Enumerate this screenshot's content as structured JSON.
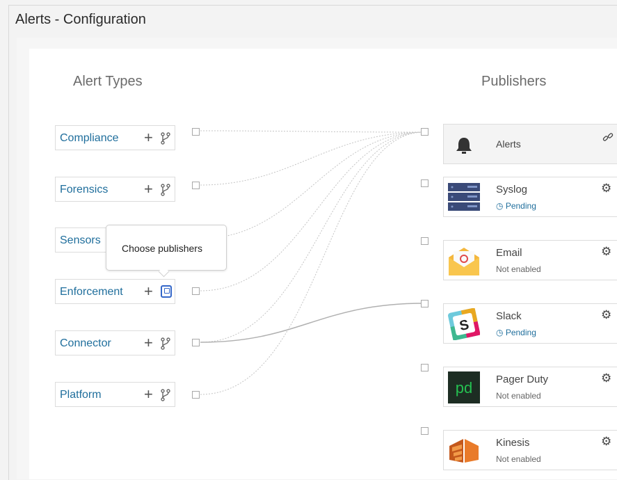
{
  "window": {
    "title": "Alerts - Configuration"
  },
  "headings": {
    "alert_types": "Alert Types",
    "publishers": "Publishers"
  },
  "alert_types": [
    {
      "label": "Compliance"
    },
    {
      "label": "Forensics"
    },
    {
      "label": "Sensors"
    },
    {
      "label": "Enforcement"
    },
    {
      "label": "Connector"
    },
    {
      "label": "Platform"
    }
  ],
  "add_symbol": "+",
  "tooltip": {
    "text": "Choose publishers"
  },
  "publishers": [
    {
      "name": "Alerts",
      "status": "",
      "icon": "bell-icon",
      "action_icon": "link-icon"
    },
    {
      "name": "Syslog",
      "status": "Pending",
      "icon": "server-icon",
      "action_icon": "gear-icon"
    },
    {
      "name": "Email",
      "status": "Not enabled",
      "icon": "email-icon",
      "action_icon": "gear-icon"
    },
    {
      "name": "Slack",
      "status": "Pending",
      "icon": "slack-icon",
      "action_icon": "gear-icon"
    },
    {
      "name": "Pager Duty",
      "status": "Not enabled",
      "icon": "pagerduty-icon",
      "action_icon": "gear-icon"
    },
    {
      "name": "Kinesis",
      "status": "Not enabled",
      "icon": "kinesis-icon",
      "action_icon": "gear-icon"
    }
  ],
  "colors": {
    "link": "#1f6e9c",
    "active_border": "#3467c9"
  }
}
